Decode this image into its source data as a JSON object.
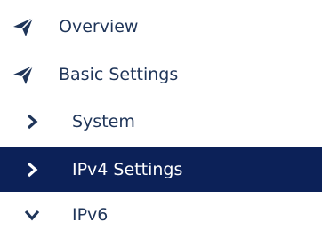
{
  "menu": {
    "items": [
      {
        "label": "Overview",
        "icon": "paper-plane-icon"
      },
      {
        "label": "Basic Settings",
        "icon": "paper-plane-icon"
      },
      {
        "label": "System",
        "icon": "chevron-right-icon"
      },
      {
        "label": "IPv4 Settings",
        "icon": "chevron-right-icon",
        "selected": true
      },
      {
        "label": "IPv6",
        "icon": "chevron-down-icon"
      }
    ]
  },
  "colors": {
    "text": "#1f3559",
    "active_background": "#0c2158",
    "active_text": "#ffffff"
  }
}
